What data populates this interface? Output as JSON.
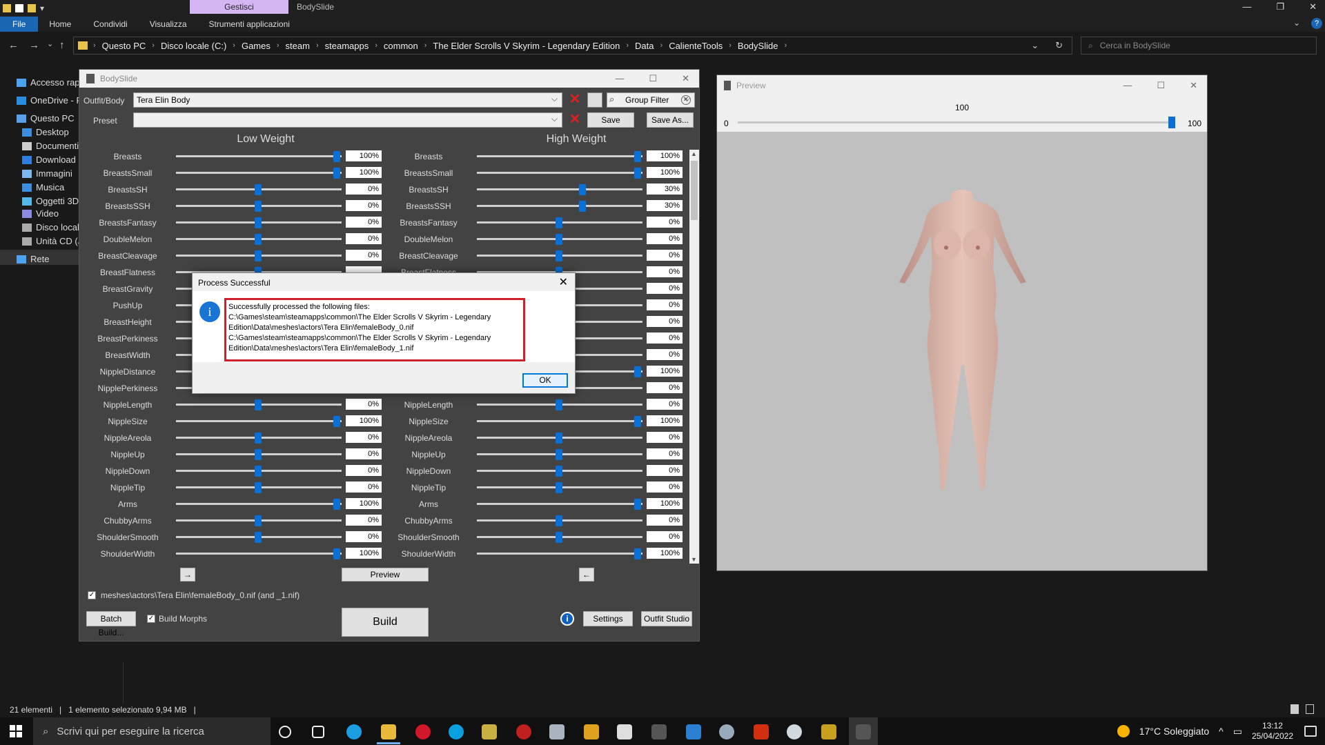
{
  "explorer": {
    "ribbon_tabs": [
      "File",
      "Home",
      "Condividi",
      "Visualizza",
      "Strumenti applicazioni"
    ],
    "context_tab": "Gestisci",
    "window_title": "BodySlide",
    "breadcrumbs": [
      "Questo PC",
      "Disco locale (C:)",
      "Games",
      "steam",
      "steamapps",
      "common",
      "The Elder Scrolls V Skyrim - Legendary Edition",
      "Data",
      "CalienteTools",
      "BodySlide"
    ],
    "search_placeholder": "Cerca in BodySlide",
    "sidebar": [
      {
        "label": "Accesso rapido",
        "color": "#4ea3f1"
      },
      {
        "label": "OneDrive - Pe",
        "color": "#2b8de0"
      },
      {
        "label": "Questo PC",
        "color": "#5aa0e8"
      },
      {
        "label": "Desktop",
        "color": "#3a8fe0"
      },
      {
        "label": "Documenti",
        "color": "#ccc"
      },
      {
        "label": "Download",
        "color": "#2f7fe0"
      },
      {
        "label": "Immagini",
        "color": "#7fb8f0"
      },
      {
        "label": "Musica",
        "color": "#3a8fe0"
      },
      {
        "label": "Oggetti 3D",
        "color": "#52b8e8"
      },
      {
        "label": "Video",
        "color": "#8a8ae0"
      },
      {
        "label": "Disco locale",
        "color": "#aaa"
      },
      {
        "label": "Unità CD (J:",
        "color": "#aaa"
      },
      {
        "label": "Rete",
        "color": "#4ea3f1"
      }
    ],
    "status": {
      "items": "21 elementi",
      "selected": "1 elemento selezionato 9,94 MB"
    }
  },
  "bodyslide": {
    "title": "BodySlide",
    "outfit_label": "Outfit/Body",
    "outfit_value": "Tera Elin Body",
    "group_filter": "Group Filter",
    "preset_label": "Preset",
    "preset_value": "",
    "save": "Save",
    "save_as": "Save As...",
    "low_weight": "Low Weight",
    "high_weight": "High Weight",
    "sliders": [
      {
        "name": "Breasts",
        "low": "100%",
        "high": "100%",
        "lv": 100,
        "hv": 100
      },
      {
        "name": "BreastsSmall",
        "low": "100%",
        "high": "100%",
        "lv": 100,
        "hv": 100
      },
      {
        "name": "BreastsSH",
        "low": "0%",
        "high": "30%",
        "lv": 50,
        "hv": 65
      },
      {
        "name": "BreastsSSH",
        "low": "0%",
        "high": "30%",
        "lv": 50,
        "hv": 65
      },
      {
        "name": "BreastsFantasy",
        "low": "0%",
        "high": "0%",
        "lv": 50,
        "hv": 50
      },
      {
        "name": "DoubleMelon",
        "low": "0%",
        "high": "0%",
        "lv": 50,
        "hv": 50
      },
      {
        "name": "BreastCleavage",
        "low": "0%",
        "high": "0%",
        "lv": 50,
        "hv": 50
      },
      {
        "name": "BreastFlatness",
        "low": "",
        "high": "0%",
        "lv": 50,
        "hv": 50
      },
      {
        "name": "BreastGravity",
        "low": "",
        "high": "0%",
        "lv": 50,
        "hv": 50
      },
      {
        "name": "PushUp",
        "low": "",
        "high": "0%",
        "lv": 50,
        "hv": 50
      },
      {
        "name": "BreastHeight",
        "low": "",
        "high": "0%",
        "lv": 50,
        "hv": 50
      },
      {
        "name": "BreastPerkiness",
        "low": "",
        "high": "0%",
        "lv": 50,
        "hv": 50
      },
      {
        "name": "BreastWidth",
        "low": "",
        "high": "0%",
        "lv": 50,
        "hv": 50
      },
      {
        "name": "NippleDistance",
        "low": "",
        "high": "100%",
        "lv": 50,
        "hv": 100
      },
      {
        "name": "NipplePerkiness",
        "low": "",
        "high": "0%",
        "lv": 50,
        "hv": 50
      },
      {
        "name": "NippleLength",
        "low": "0%",
        "high": "0%",
        "lv": 50,
        "hv": 50
      },
      {
        "name": "NippleSize",
        "low": "100%",
        "high": "100%",
        "lv": 100,
        "hv": 100
      },
      {
        "name": "NippleAreola",
        "low": "0%",
        "high": "0%",
        "lv": 50,
        "hv": 50
      },
      {
        "name": "NippleUp",
        "low": "0%",
        "high": "0%",
        "lv": 50,
        "hv": 50
      },
      {
        "name": "NippleDown",
        "low": "0%",
        "high": "0%",
        "lv": 50,
        "hv": 50
      },
      {
        "name": "NippleTip",
        "low": "0%",
        "high": "0%",
        "lv": 50,
        "hv": 50
      },
      {
        "name": "Arms",
        "low": "100%",
        "high": "100%",
        "lv": 100,
        "hv": 100
      },
      {
        "name": "ChubbyArms",
        "low": "0%",
        "high": "0%",
        "lv": 50,
        "hv": 50
      },
      {
        "name": "ShoulderSmooth",
        "low": "0%",
        "high": "0%",
        "lv": 50,
        "hv": 50
      },
      {
        "name": "ShoulderWidth",
        "low": "100%",
        "high": "100%",
        "lv": 100,
        "hv": 100
      }
    ],
    "arrow_right": "→",
    "arrow_left": "←",
    "preview_btn": "Preview",
    "output_path": "meshes\\actors\\Tera Elin\\femaleBody_0.nif (and _1.nif)",
    "batch_build": "Batch Build...",
    "build_morphs": "Build Morphs",
    "build": "Build",
    "settings": "Settings",
    "outfit_studio": "Outfit Studio"
  },
  "dialog": {
    "title": "Process Successful",
    "message_lines": [
      "Successfully processed the following files:",
      "C:\\Games\\steam\\steamapps\\common\\The Elder Scrolls V Skyrim - Legendary",
      "Edition\\Data\\meshes\\actors\\Tera Elin\\femaleBody_0.nif",
      "C:\\Games\\steam\\steamapps\\common\\The Elder Scrolls V Skyrim - Legendary",
      "Edition\\Data\\meshes\\actors\\Tera Elin\\femaleBody_1.nif"
    ],
    "ok": "OK"
  },
  "preview": {
    "title": "Preview",
    "weight_value": "100",
    "min": "0",
    "max": "100",
    "weight_fraction": 1.0
  },
  "taskbar": {
    "search_placeholder": "Scrivi qui per eseguire la ricerca",
    "weather": "17°C Soleggiato",
    "time": "13:12",
    "date": "25/04/2022"
  }
}
